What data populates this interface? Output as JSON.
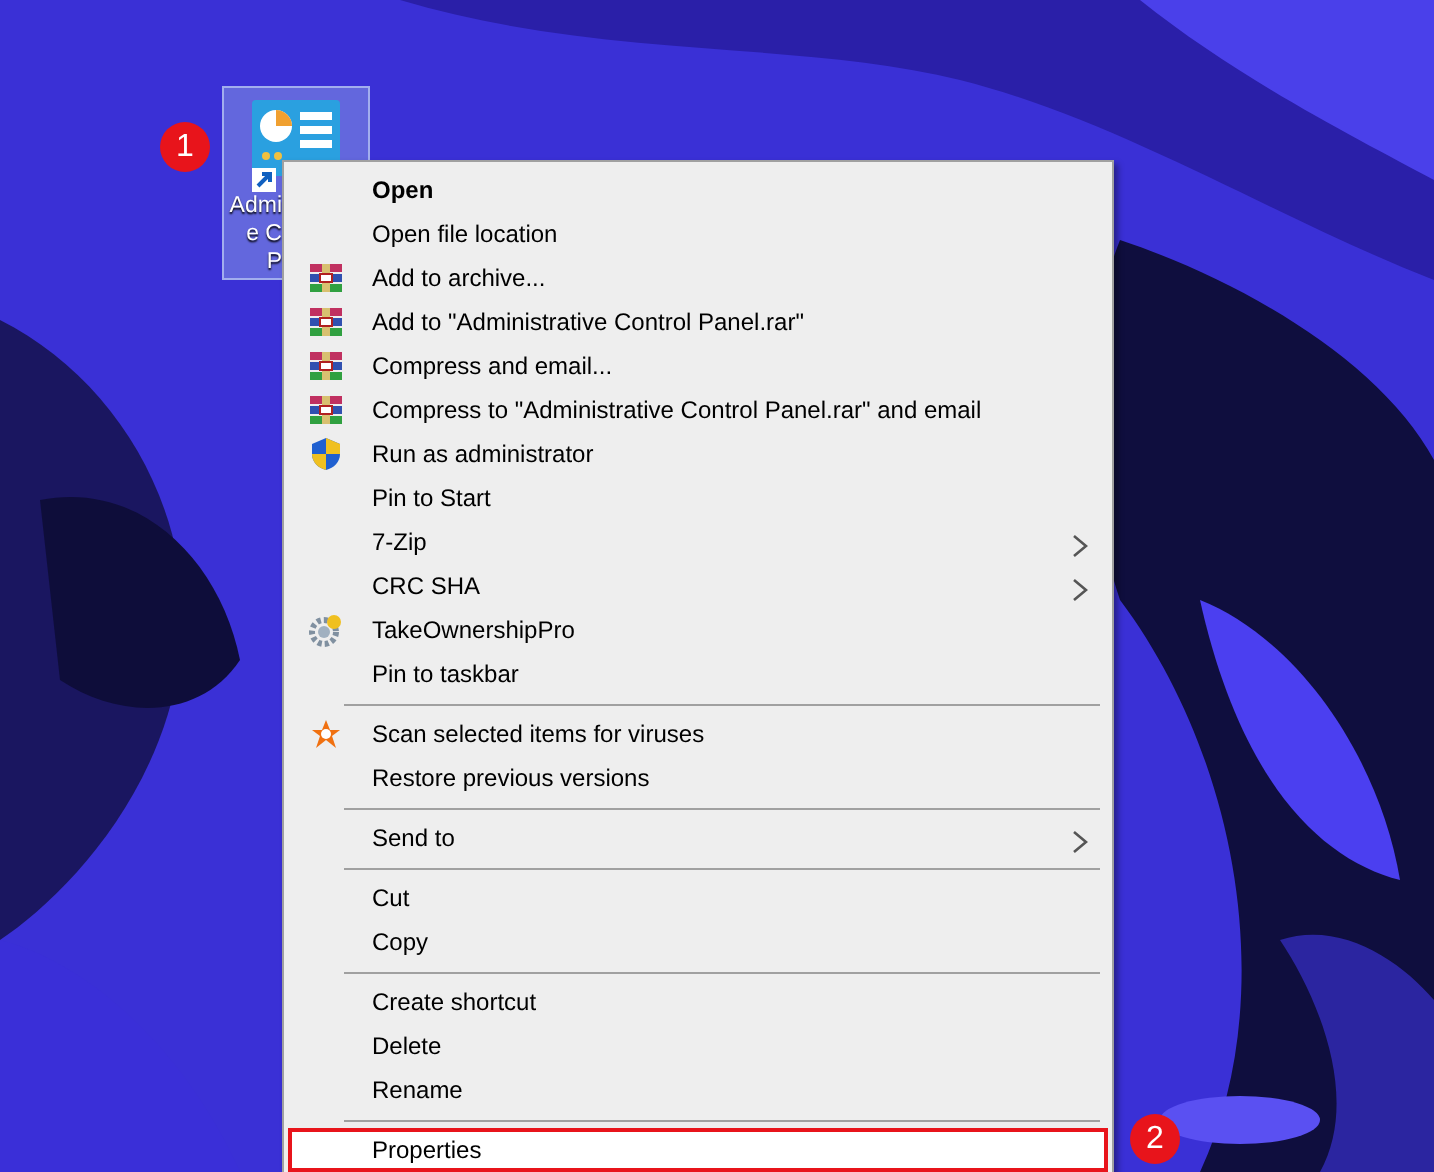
{
  "desktop_icon": {
    "label_lines": [
      "Admi",
      "e C",
      "P"
    ],
    "selected": true
  },
  "context_menu": {
    "items": [
      {
        "kind": "item",
        "label": "Open",
        "default": true,
        "selected": false
      },
      {
        "kind": "item",
        "label": "Open file location",
        "selected": false
      },
      {
        "kind": "archive",
        "label": "Add to archive...",
        "selected": false
      },
      {
        "kind": "archive",
        "label": "Add to \"Administrative Control Panel.rar\"",
        "selected": false
      },
      {
        "kind": "archive",
        "label": "Compress and email...",
        "selected": false
      },
      {
        "kind": "archive",
        "label": "Compress to \"Administrative Control Panel.rar\" and email",
        "selected": false
      },
      {
        "kind": "shield",
        "label": "Run as administrator",
        "selected": false
      },
      {
        "kind": "item",
        "label": "Pin to Start",
        "selected": false
      },
      {
        "kind": "item",
        "label": "7-Zip",
        "submenu": true,
        "selected": false
      },
      {
        "kind": "item",
        "label": "CRC SHA",
        "submenu": true,
        "selected": false
      },
      {
        "kind": "gear",
        "label": "TakeOwnershipPro",
        "selected": false
      },
      {
        "kind": "item",
        "label": "Pin to taskbar",
        "selected": false
      },
      {
        "kind": "separator"
      },
      {
        "kind": "antivirus",
        "label": "Scan selected items for viruses",
        "selected": false
      },
      {
        "kind": "item",
        "label": "Restore previous versions",
        "selected": false
      },
      {
        "kind": "separator"
      },
      {
        "kind": "item",
        "label": "Send to",
        "submenu": true,
        "selected": false
      },
      {
        "kind": "separator"
      },
      {
        "kind": "item",
        "label": "Cut",
        "selected": false
      },
      {
        "kind": "item",
        "label": "Copy",
        "selected": false
      },
      {
        "kind": "separator"
      },
      {
        "kind": "item",
        "label": "Create shortcut",
        "selected": false
      },
      {
        "kind": "item",
        "label": "Delete",
        "selected": false
      },
      {
        "kind": "item",
        "label": "Rename",
        "selected": false
      },
      {
        "kind": "separator"
      },
      {
        "kind": "item",
        "label": "Properties",
        "selected": true,
        "outlined": true
      }
    ]
  },
  "step_badges": [
    {
      "label": "1"
    },
    {
      "label": "2"
    }
  ]
}
